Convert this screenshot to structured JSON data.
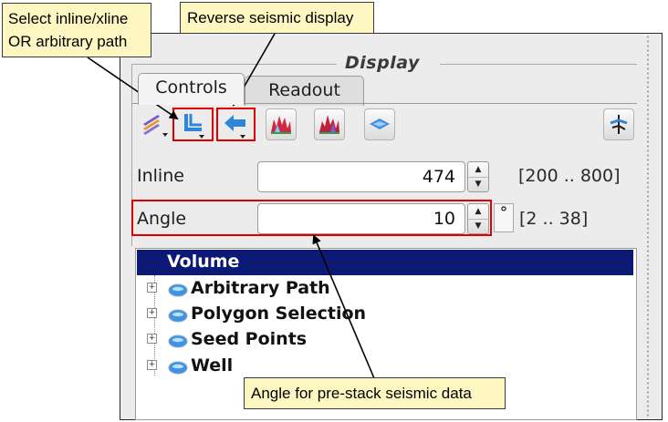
{
  "panel": {
    "group_title": "Display",
    "tabs": [
      {
        "label": "Controls",
        "active": true
      },
      {
        "label": "Readout",
        "active": false
      }
    ]
  },
  "toolbar": {
    "buttons": [
      "layers-menu-icon",
      "inline-xline-arbitrary-path-icon",
      "reverse-seismic-display-icon",
      "seismic-wiggle-icon-1",
      "seismic-wiggle-icon-2",
      "horizon-icon",
      "well-tie-icon"
    ]
  },
  "inline": {
    "label": "Inline",
    "value": "474",
    "range": "[200 .. 800]"
  },
  "angle": {
    "label": "Angle",
    "value": "10",
    "unit": "°",
    "range": "[2 .. 38]"
  },
  "tree": {
    "items": [
      {
        "label": "Volume",
        "selected": true
      },
      {
        "label": "Arbitrary Path"
      },
      {
        "label": "Polygon Selection"
      },
      {
        "label": "Seed Points"
      },
      {
        "label": "Well"
      }
    ],
    "expander": "+"
  },
  "callouts": {
    "select_path": "Select inline/xline OR arbitrary path",
    "reverse": "Reverse seismic display",
    "angle": "Angle for pre-stack seismic data"
  },
  "colors": {
    "callout_bg": "#fff7c2",
    "highlight_border": "#e00000",
    "tree_selection": "#0c1975",
    "accent_blue": "#2f86d8"
  }
}
